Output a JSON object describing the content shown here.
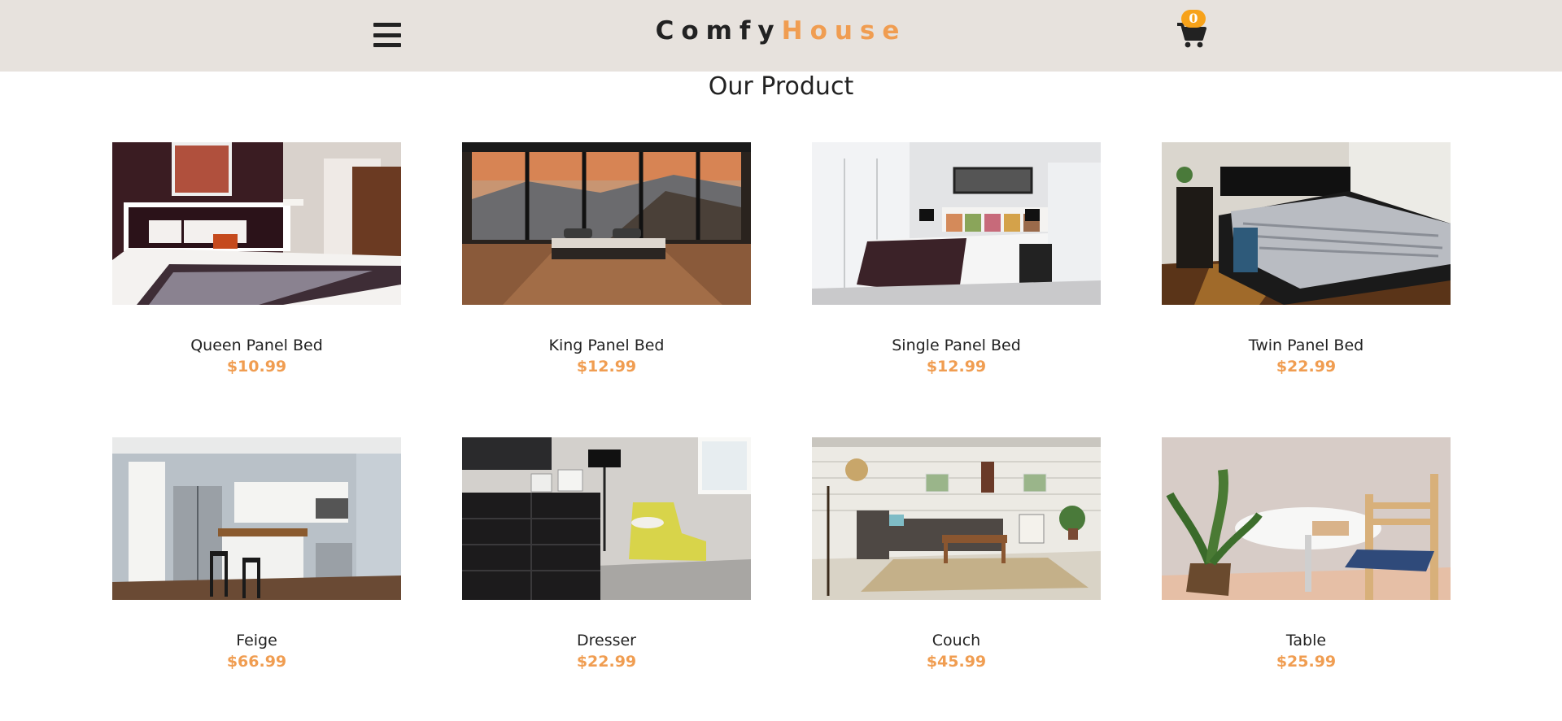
{
  "navbar": {
    "logo_part1": "Comfy",
    "logo_part2": "House",
    "cart_count": "0",
    "menu_icon": "menu-icon",
    "cart_icon": "cart-icon"
  },
  "products_section": {
    "title": "Our Product"
  },
  "colors": {
    "accent": "#f09d51",
    "navbar_bg": "#e7e2dd",
    "badge": "#f7a21a"
  },
  "products": [
    {
      "name": "Queen Panel Bed",
      "price": "$10.99"
    },
    {
      "name": "King Panel Bed",
      "price": "$12.99"
    },
    {
      "name": "Single Panel Bed",
      "price": "$12.99"
    },
    {
      "name": "Twin Panel Bed",
      "price": "$22.99"
    },
    {
      "name": "Feige",
      "price": "$66.99"
    },
    {
      "name": "Dresser",
      "price": "$22.99"
    },
    {
      "name": "Couch",
      "price": "$45.99"
    },
    {
      "name": "Table",
      "price": "$25.99"
    }
  ]
}
